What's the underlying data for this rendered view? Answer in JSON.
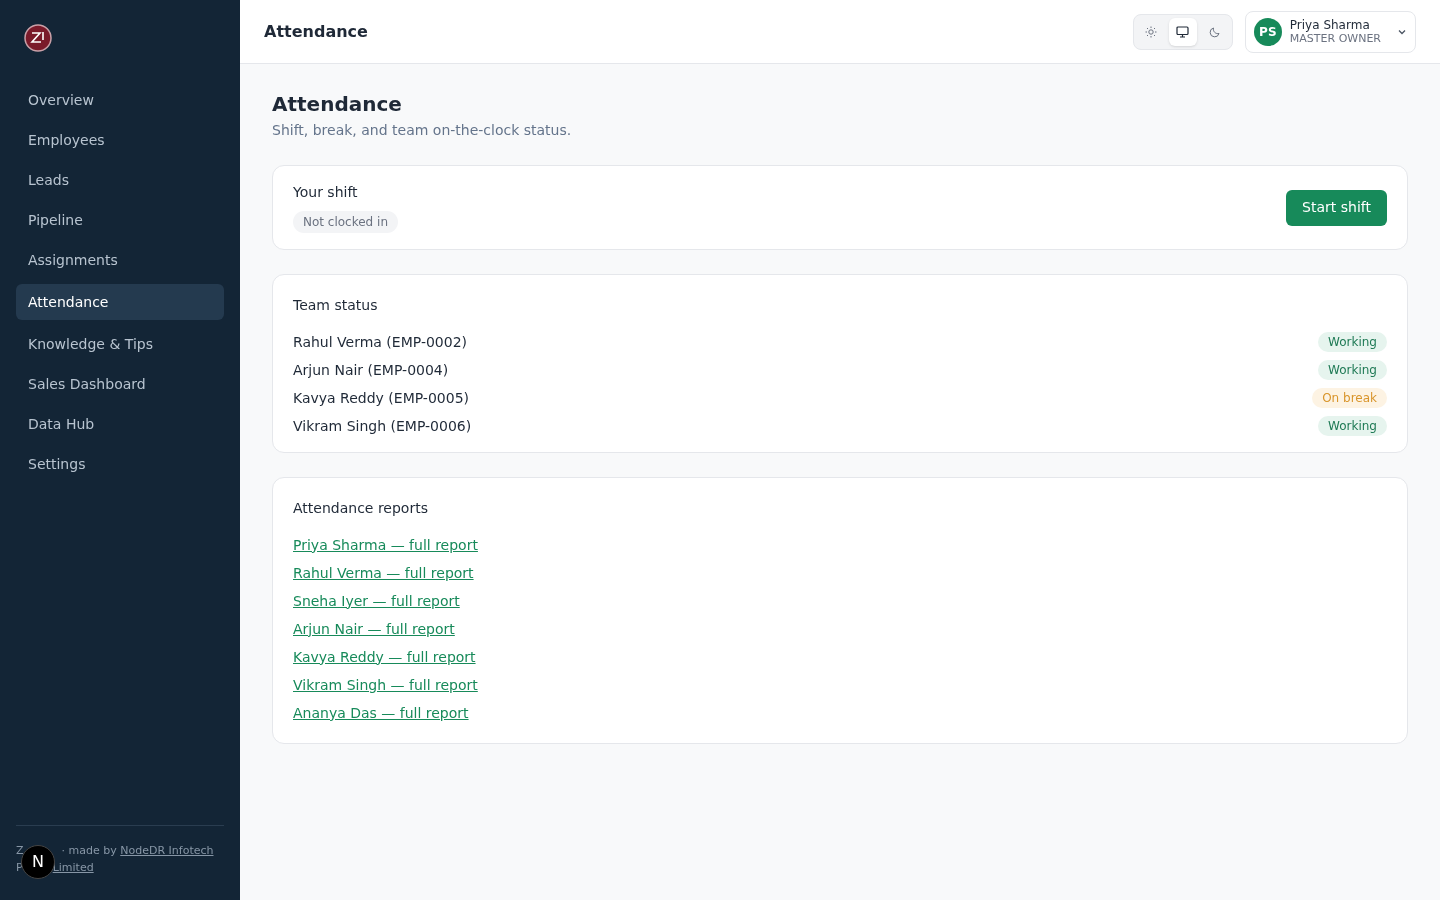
{
  "sidebar": {
    "items": [
      {
        "label": "Overview",
        "selected": false
      },
      {
        "label": "Employees",
        "selected": false
      },
      {
        "label": "Leads",
        "selected": false
      },
      {
        "label": "Pipeline",
        "selected": false
      },
      {
        "label": "Assignments",
        "selected": false
      },
      {
        "label": "Attendance",
        "selected": true
      },
      {
        "label": "Knowledge & Tips",
        "selected": false
      },
      {
        "label": "Sales Dashboard",
        "selected": false
      },
      {
        "label": "Data Hub",
        "selected": false
      },
      {
        "label": "Settings",
        "selected": false
      }
    ],
    "footer": {
      "line_1_start": "Z",
      "text": "· made by",
      "link": "NodeDR Infotech",
      "line_2_start": "P",
      "link_2": "Limited"
    },
    "badge": "N"
  },
  "header": {
    "title": "Attendance",
    "theme_options": [
      {
        "kind": "light",
        "selected": false
      },
      {
        "kind": "system",
        "selected": true
      },
      {
        "kind": "dark",
        "selected": false
      }
    ],
    "user": {
      "initials": "PS",
      "name": "Priya Sharma",
      "role": "MASTER OWNER"
    }
  },
  "page": {
    "title": "Attendance",
    "subtitle": "Shift, break, and team on-the-clock status."
  },
  "shift": {
    "title": "Your shift",
    "status": "Not clocked in",
    "button": "Start shift"
  },
  "team": {
    "title": "Team status",
    "members": [
      {
        "name": "Rahul Verma (EMP-0002)",
        "status": "Working",
        "kind": "working"
      },
      {
        "name": "Arjun Nair (EMP-0004)",
        "status": "Working",
        "kind": "working"
      },
      {
        "name": "Kavya Reddy (EMP-0005)",
        "status": "On break",
        "kind": "break"
      },
      {
        "name": "Vikram Singh (EMP-0006)",
        "status": "Working",
        "kind": "working"
      }
    ]
  },
  "reports": {
    "title": "Attendance reports",
    "links": [
      "Priya Sharma — full report",
      "Rahul Verma — full report",
      "Sneha Iyer — full report",
      "Arjun Nair — full report",
      "Kavya Reddy — full report",
      "Vikram Singh — full report",
      "Ananya Das — full report"
    ]
  }
}
